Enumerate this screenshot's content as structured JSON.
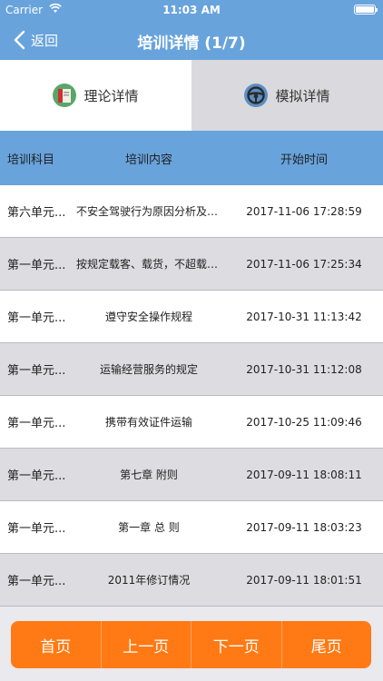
{
  "status": {
    "carrier": "Carrier",
    "time": "11:03 AM"
  },
  "nav": {
    "back_label": "返回",
    "title": "培训详情 (1/7)"
  },
  "tabs": [
    {
      "label": "理论详情",
      "icon": "book-icon",
      "active": true
    },
    {
      "label": "模拟详情",
      "icon": "steering-wheel-icon",
      "active": false
    }
  ],
  "table": {
    "headers": {
      "subject": "培训科目",
      "content": "培训内容",
      "time": "开始时间"
    },
    "rows": [
      {
        "subject": "第六单元...",
        "content": "不安全驾驶行为原因分析及其...",
        "time": "2017-11-06 17:28:59"
      },
      {
        "subject": "第一单元...",
        "content": "按规定载客、载货，不超载运输",
        "time": "2017-11-06 17:25:34"
      },
      {
        "subject": "第一单元...",
        "content": "遵守安全操作规程",
        "time": "2017-10-31 11:13:42"
      },
      {
        "subject": "第一单元...",
        "content": "运输经营服务的规定",
        "time": "2017-10-31 11:12:08"
      },
      {
        "subject": "第一单元...",
        "content": "携带有效证件运输",
        "time": "2017-10-25 11:09:46"
      },
      {
        "subject": "第一单元...",
        "content": "第七章 附则",
        "time": "2017-09-11 18:08:11"
      },
      {
        "subject": "第一单元...",
        "content": "第一章 总 则",
        "time": "2017-09-11 18:03:23"
      },
      {
        "subject": "第一单元...",
        "content": "2011年修订情况",
        "time": "2017-09-11 18:01:51"
      }
    ]
  },
  "pager": {
    "first": "首页",
    "prev": "上一页",
    "next": "下一页",
    "last": "尾页"
  },
  "colors": {
    "primary": "#68a3dc",
    "accent": "#ff7a14"
  }
}
